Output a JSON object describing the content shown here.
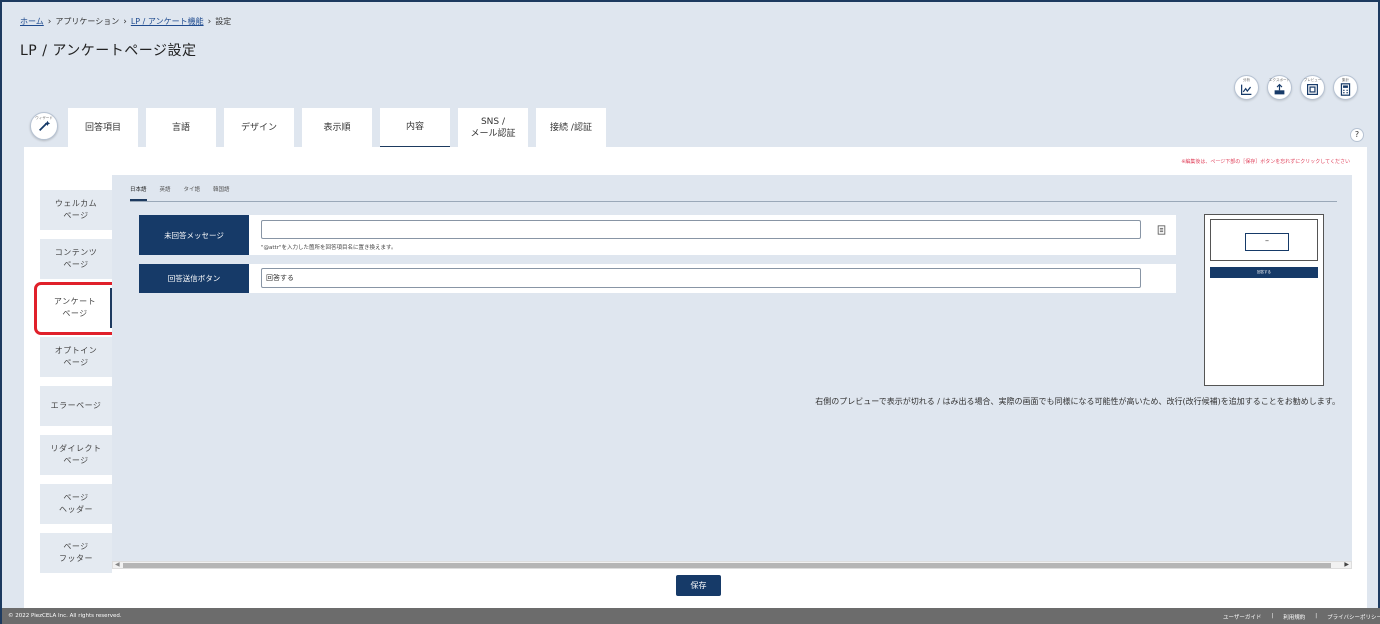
{
  "breadcrumb": {
    "home": "ホーム",
    "applications": "アプリケーション",
    "lp": "LP / アンケート機能",
    "current": "設定"
  },
  "page_title": "LP / アンケートページ設定",
  "top_icons": [
    {
      "mini": "分析",
      "icon": "chart-icon"
    },
    {
      "mini": "エクスポート",
      "icon": "export-icon"
    },
    {
      "mini": "プレビュー",
      "icon": "preview-icon"
    },
    {
      "mini": "集計",
      "icon": "calculator-icon"
    }
  ],
  "wand_mini": "ウィザード",
  "tabs": [
    {
      "label": "回答項目"
    },
    {
      "label": "言語"
    },
    {
      "label": "デザイン"
    },
    {
      "label": "表示順"
    },
    {
      "label": "内容",
      "active": true
    },
    {
      "label_line1": "SNS /",
      "label_line2": "メール認証"
    },
    {
      "label": "接続 /認証"
    }
  ],
  "help": "?",
  "warning": "※編集後は、ページ下部の［保存］ボタンを忘れずにクリックしてください",
  "nav": [
    {
      "line1": "ウェルカム",
      "line2": "ページ"
    },
    {
      "line1": "コンテンツ",
      "line2": "ページ"
    },
    {
      "line1": "アンケート",
      "line2": "ページ",
      "active": true
    },
    {
      "line1": "オプトイン",
      "line2": "ページ"
    },
    {
      "line1": "エラーページ",
      "line2": ""
    },
    {
      "line1": "リダイレクト",
      "line2": "ページ"
    },
    {
      "line1": "ページ",
      "line2": "ヘッダー"
    },
    {
      "line1": "ページ",
      "line2": "フッター"
    }
  ],
  "lang_tabs": [
    "日本語",
    "英語",
    "タイ語",
    "韓国語"
  ],
  "form": {
    "row1_label": "未回答メッセージ",
    "row1_value": "",
    "row1_hint": "\"@attr\"を入力した箇所を回答項目名に置き換えます。",
    "row2_label": "回答送信ボタン",
    "row2_value": "回答する"
  },
  "preview": {
    "input_value": "–",
    "button_label": "回答する"
  },
  "preview_note": "右側のプレビューで表示が切れる / はみ出る場合、実際の画面でも同様になる可能性が高いため、改行(改行候補)を追加することをお勧めします。",
  "save_label": "保存",
  "footer": {
    "copyright": "© 2022 PiezCELA Inc. All rights reserved.",
    "links": [
      "ユーザーガイド",
      "|",
      "利用規約",
      "|",
      "プライバシーポリシー"
    ]
  }
}
